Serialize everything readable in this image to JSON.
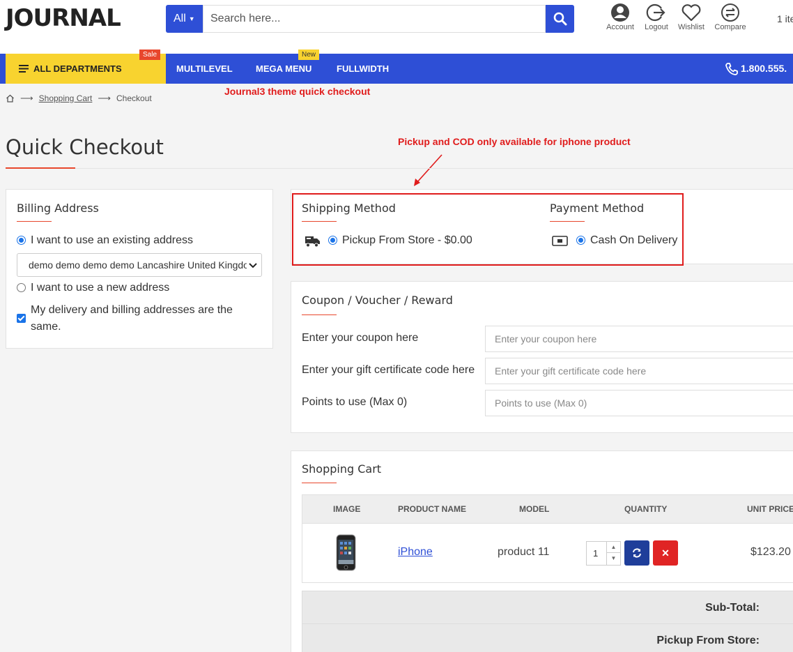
{
  "header": {
    "logo": "JOURNAL",
    "search": {
      "category": "All",
      "placeholder": "Search here..."
    },
    "icons": [
      {
        "label": "Account",
        "icon": "account-icon"
      },
      {
        "label": "Logout",
        "icon": "logout-icon"
      },
      {
        "label": "Wishlist",
        "icon": "heart-icon"
      },
      {
        "label": "Compare",
        "icon": "compare-icon"
      }
    ],
    "cart": "1 ite"
  },
  "nav": {
    "all_departments": "ALL DEPARTMENTS",
    "sale_badge": "Sale",
    "new_badge": "New",
    "items": [
      "MULTILEVEL",
      "MEGA MENU",
      "FULLWIDTH"
    ],
    "phone": "1.800.555."
  },
  "annotations": {
    "theme": "Journal3 theme quick checkout",
    "pickup": "Pickup and COD only available for iphone product"
  },
  "breadcrumb": {
    "items": [
      "Shopping Cart",
      "Checkout"
    ]
  },
  "page_title": "Quick Checkout",
  "billing": {
    "title": "Billing Address",
    "existing_label": "I want to use an existing address",
    "address_selected": "demo demo demo demo Lancashire United Kingdom",
    "new_label": "I want to use a new address",
    "same_address_label": "My delivery and billing addresses are the same."
  },
  "shipping": {
    "title": "Shipping Method",
    "option": "Pickup From Store - $0.00"
  },
  "payment": {
    "title": "Payment Method",
    "option": "Cash On Delivery"
  },
  "coupon": {
    "title": "Coupon / Voucher / Reward",
    "rows": [
      {
        "label": "Enter your coupon here",
        "placeholder": "Enter your coupon here"
      },
      {
        "label": "Enter your gift certificate code here",
        "placeholder": "Enter your gift certificate code here"
      },
      {
        "label": "Points to use (Max 0)",
        "placeholder": "Points to use (Max 0)"
      }
    ]
  },
  "cart": {
    "title": "Shopping Cart",
    "columns": [
      "IMAGE",
      "PRODUCT NAME",
      "MODEL",
      "QUANTITY",
      "UNIT PRICE"
    ],
    "item": {
      "name": "iPhone",
      "model": "product 11",
      "quantity": "1",
      "unit_price": "$123.20"
    },
    "totals": [
      "Sub-Total:",
      "Pickup From Store:"
    ]
  },
  "colors": {
    "primary": "#2e4fd6",
    "accent": "#e8472c",
    "yellow": "#f8d32f",
    "annotation": "#e01c1c"
  }
}
